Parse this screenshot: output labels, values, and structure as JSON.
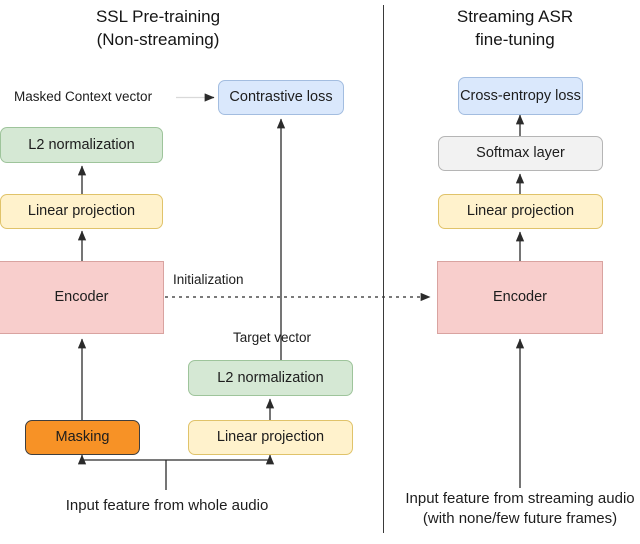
{
  "figure": {
    "panels": [
      {
        "id": "ssl",
        "title": "SSL Pre-training\n(Non-streaming)"
      },
      {
        "id": "asr",
        "title": "Streaming ASR\nfine-tuning"
      }
    ]
  },
  "left": {
    "nodes": {
      "l2_norm_top": "L2 normalization",
      "linear_projection_top": "Linear projection",
      "encoder": "Encoder",
      "masking": "Masking",
      "linear_projection_bottom": "Linear projection",
      "l2_norm_bottom": "L2 normalization",
      "contrastive_loss": "Contrastive loss"
    },
    "labels": {
      "masked_context_vector": "Masked Context vector",
      "target_vector": "Target vector",
      "input_feature": "Input feature from whole audio"
    }
  },
  "right": {
    "nodes": {
      "cross_entropy_loss": "Cross-entropy\nloss",
      "softmax_layer": "Softmax layer",
      "linear_projection": "Linear projection",
      "encoder": "Encoder"
    },
    "labels": {
      "input_feature": "Input feature from streaming audio\n(with none/few future frames)"
    }
  },
  "connectors": {
    "initialization": "Initialization"
  },
  "colors": {
    "green": "#d5e8d4",
    "yellow": "#fff2cc",
    "pink": "#f8cecc",
    "blue": "#dae8fc",
    "grey": "#f2f2f2",
    "orange": "#f79226",
    "stroke": "#3a3a3a",
    "background": "#ffffff"
  }
}
